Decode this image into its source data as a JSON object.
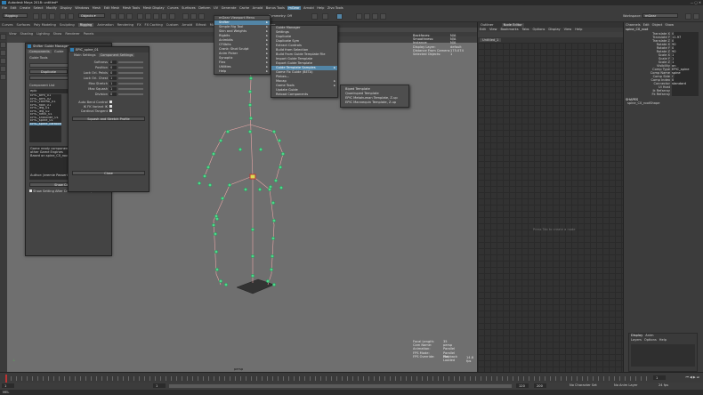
{
  "app": {
    "title": "Autodesk Maya 2018: untitled*",
    "window_item": "spine_C0_root"
  },
  "menus": [
    "File",
    "Edit",
    "Create",
    "Select",
    "Modify",
    "Display",
    "Windows",
    "Mesh",
    "Edit Mesh",
    "Mesh Tools",
    "Mesh Display",
    "Curves",
    "Surfaces",
    "Deform",
    "UV",
    "Generate",
    "Cache",
    "Arnold",
    "Bonus Tools",
    "mGear",
    "Arnold",
    "Help",
    "Zivo Tools"
  ],
  "status": {
    "mode": "Rigging",
    "symmetry": "Symmetry: Off",
    "workspace_label": "Workspace:",
    "workspace": "mGear"
  },
  "shelf_tabs": [
    "Curves",
    "Surfaces",
    "Poly Modeling",
    "Sculpting",
    "Rigging",
    "Animation",
    "Rendering",
    "FX",
    "FX Caching",
    "Custom",
    "Arnold",
    "Bifrost",
    "MASH",
    "Motion Graphics",
    "XGen",
    "mGear"
  ],
  "shelf_active": "Rigging",
  "viewport": {
    "menu": [
      "View",
      "Shading",
      "Lighting",
      "Show",
      "Renderer",
      "Panels"
    ],
    "camera": "persp",
    "hud_left": [
      "Verts:",
      "Edges:",
      "Faces:",
      "Tris:",
      "UVs:"
    ],
    "hud_bottom": [
      "Focal Length:",
      "Cam Name:",
      "Animation:",
      "FPS Mode:",
      "FPS Override:"
    ],
    "hud_bottom_vals": [
      "35",
      "persp",
      "Parallel",
      "Parallel Playback",
      "Not Loaded"
    ],
    "hud_top": [
      {
        "k": "Backfaces:",
        "v": "N/A"
      },
      {
        "k": "Smoothness:",
        "v": "N/A"
      },
      {
        "k": "Instance:",
        "v": "N/A"
      },
      {
        "k": "Display Layer:",
        "v": "default"
      },
      {
        "k": "Distance From Camera:",
        "v": "175.074"
      },
      {
        "k": "Selected Objects:",
        "v": "1"
      }
    ],
    "fps": "14.8 fps"
  },
  "mgear_menu": {
    "title": "mGear Viewport Menu",
    "items": [
      "Shifter",
      "Simple Rig Tool",
      "Skin and Weights",
      "Rigbits",
      "Animbits",
      "CFXbits",
      "Crank: Shot Sculpt",
      "Anim Picker",
      "Synoptic",
      "Flex",
      "Utilities",
      "Help"
    ],
    "highlight": "Shifter"
  },
  "shifter_menu": {
    "items": [
      "Guide Manager",
      "Settings",
      "Duplicate",
      "Duplicate Sym",
      "Extract Controls",
      "Build from Selection",
      "Build From Guide Template File",
      "Import Guide Template",
      "Export Guide Template",
      "Guide Template Samples",
      "Game Fix Guide (BETA)",
      "Plebes...",
      "Mocap",
      "Game Tools",
      "Update Guide",
      "Reload Components"
    ],
    "highlight": "Guide Template Samples"
  },
  "template_menu": {
    "items": [
      "Biped Template",
      "Quadruped Template",
      "EPIC Metahuman Template, Z-up",
      "EPIC Mannequin Template, Z-up"
    ]
  },
  "guide_manager": {
    "title": "Shifter Guide Manager",
    "tabs": [
      "Components",
      "Guide"
    ],
    "buttons": [
      "Guide Tools",
      "Duplicate",
      "Build Fro..."
    ],
    "list_label": "Component List",
    "search": "epic",
    "list": [
      "EPIC_arm_01",
      "EPIC_arm_02",
      "EPIC_control_01",
      "EPIC_foot_01",
      "EPIC_leg_01",
      "EPIC_leg_02",
      "EPIC_neck_01",
      "EPIC_shoulder_01",
      "EPIC_spine_01",
      "EPIC_spine_cartoon_01"
    ],
    "selected": "EPIC_spine_cartoon_01",
    "description": "Game ready component for EPIC's UE and other Game Engines\nBased on spine_C0_root",
    "author": "Author: Jeremie Passerin, Miquel Campos, ...",
    "show_btn": "Show Component",
    "checkbox": "Show Setting After Create New Component"
  },
  "spine_settings": {
    "title": "EPIC_spine_01",
    "tabs": [
      "Main Settings",
      "Component Settings"
    ],
    "active_tab": "Component Settings",
    "rows": [
      {
        "k": "Softness",
        "v": "0"
      },
      {
        "k": "Position",
        "v": "0"
      },
      {
        "k": "Lock Ori. Pelvis",
        "v": "0"
      },
      {
        "k": "Lock Ori. Chest",
        "v": "1"
      },
      {
        "k": "Max Stretch",
        "v": "1"
      },
      {
        "k": "Max Squash",
        "v": "1"
      },
      {
        "k": "Division",
        "v": "0"
      }
    ],
    "checks": [
      "Auto Bend Control",
      "IK FK Variant IK",
      "Cardinal Tangent"
    ],
    "squash_btn": "Squash and Stretch Profile",
    "close": "Close"
  },
  "node_editor": {
    "label": "Outliner",
    "title": "Node Editor",
    "menu": [
      "Edit",
      "View",
      "Bookmarks",
      "Tabs",
      "Options",
      "Display",
      "View",
      "Help"
    ],
    "tab": "Untitled_1",
    "hint": "Press Tab to create a node"
  },
  "channel_box": {
    "tabs": [
      "Channels",
      "Edit",
      "Object",
      "Show"
    ],
    "object": "spine_C0_root",
    "attrs": [
      {
        "k": "Translate X",
        "v": "0"
      },
      {
        "k": "Translate Y",
        "v": "11.97"
      },
      {
        "k": "Translate Z",
        "v": "0"
      },
      {
        "k": "Rotate X",
        "v": "90"
      },
      {
        "k": "Rotate Y",
        "v": "0"
      },
      {
        "k": "Rotate Z",
        "v": "90"
      },
      {
        "k": "Scale X",
        "v": "1"
      },
      {
        "k": "Scale Y",
        "v": "1"
      },
      {
        "k": "Scale Z",
        "v": "1"
      },
      {
        "k": "Visibility",
        "v": "on"
      },
      {
        "k": "Comp Type",
        "v": "EPIC_spine"
      },
      {
        "k": "Comp Name",
        "v": "spine"
      },
      {
        "k": "Comp Side",
        "v": "C"
      },
      {
        "k": "Comp Index",
        "v": "0"
      },
      {
        "k": "Connector",
        "v": "standard"
      },
      {
        "k": "Ui Host",
        "v": ""
      },
      {
        "k": "Ik Refarray",
        "v": ""
      },
      {
        "k": "Fk Refarray",
        "v": ""
      }
    ],
    "section": "SHAPES",
    "shape": "spine_C0_rootShape",
    "layer_tabs": [
      "Display",
      "Anim"
    ],
    "layer_menu": [
      "Layers",
      "Options",
      "Help"
    ]
  },
  "timeline": {
    "start": "1",
    "end": "120",
    "current": "1",
    "range_start": "1",
    "range_end": "120",
    "range_end2": "200",
    "char_set": "No Character Set",
    "anim_layer": "No Anim Layer",
    "fps": "24 fps"
  },
  "cmd": {
    "label": "MEL"
  }
}
